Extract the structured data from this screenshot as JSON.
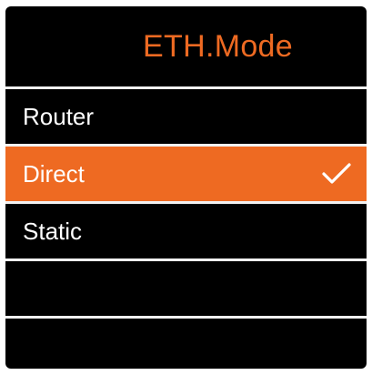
{
  "header": {
    "title": "ETH.Mode"
  },
  "menu": {
    "items": [
      {
        "label": "Router",
        "selected": false
      },
      {
        "label": "Direct",
        "selected": true
      },
      {
        "label": "Static",
        "selected": false
      }
    ]
  },
  "colors": {
    "accent": "#ee6a22",
    "background": "#000000",
    "text": "#ffffff",
    "divider": "#f2f2f2"
  },
  "icons": {
    "selected_indicator": "check-icon"
  }
}
